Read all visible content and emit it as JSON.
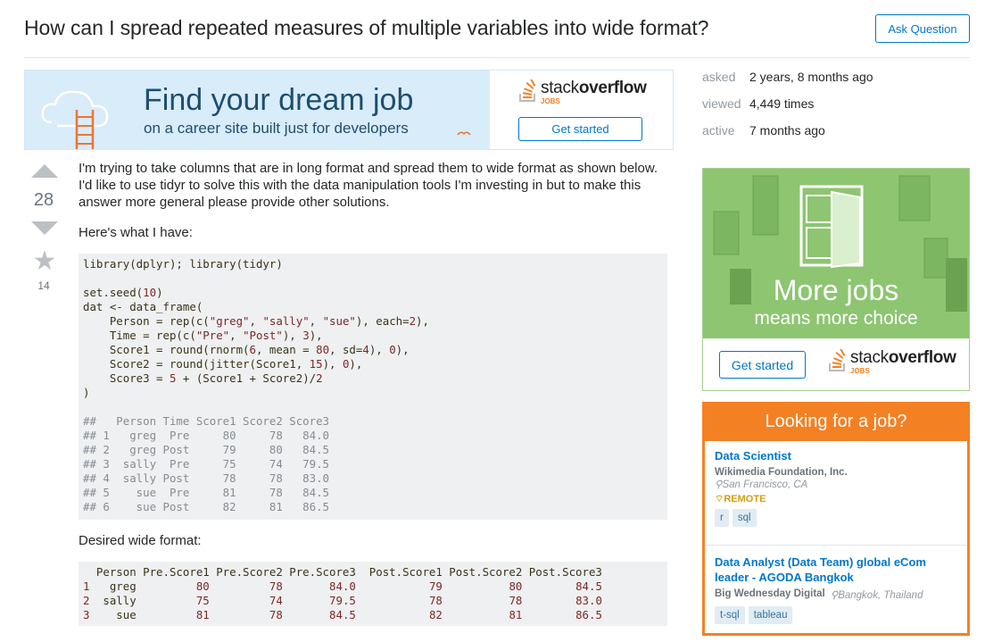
{
  "question": {
    "title": "How can I spread repeated measures of multiple variables into wide format?",
    "ask_button": "Ask Question",
    "votes": "28",
    "favorites": "14",
    "para1": "I'm trying to take columns that are in long format and spread them to wide format as shown below. I'd like to use tidyr to solve this with the data manipulation tools I'm investing in but to make this answer more general please provide other solutions.",
    "para2": "Here's what I have:",
    "para3": "Desired wide format:"
  },
  "banner_ad": {
    "headline": "Find your dream job",
    "subline": "on a career site built just for developers",
    "logo_word_light": "stack",
    "logo_word_bold": "overflow",
    "logo_jobs": "JOBS",
    "button": "Get started"
  },
  "stats": {
    "asked_label": "asked",
    "asked_value": "2 years, 8 months ago",
    "viewed_label": "viewed",
    "viewed_value": "4,449 times",
    "active_label": "active",
    "active_value": "7 months ago"
  },
  "side_ad": {
    "line1": "More jobs",
    "line2": "means more choice",
    "button": "Get started",
    "logo_word_light": "stack",
    "logo_word_bold": "overflow",
    "logo_jobs": "JOBS"
  },
  "jobs": {
    "header": "Looking for a job?",
    "items": [
      {
        "title": "Data Scientist",
        "company": "Wikimedia Foundation, Inc.",
        "location": "San Francisco, CA",
        "remote": "REMOTE",
        "tags": [
          "r",
          "sql"
        ]
      },
      {
        "title": "Data Analyst (Data Team) global eCom leader - AGODA Bangkok",
        "company": "Big Wednesday Digital",
        "location": "Bangkok, Thailand",
        "tags": [
          "t-sql",
          "tableau"
        ]
      }
    ]
  },
  "code1": {
    "lines": [
      "library(dplyr); library(tidyr)",
      "",
      "set.seed(10)",
      "dat <- data_frame(",
      "    Person = rep(c(\"greg\", \"sally\", \"sue\"), each=2),",
      "    Time = rep(c(\"Pre\", \"Post\"), 3),",
      "    Score1 = round(rnorm(6, mean = 80, sd=4), 0),",
      "    Score2 = round(jitter(Score1, 15), 0),",
      "    Score3 = 5 + (Score1 + Score2)/2",
      ")",
      "",
      "##   Person Time Score1 Score2 Score3",
      "## 1   greg  Pre     80     78   84.0",
      "## 2   greg Post     79     80   84.5",
      "## 3  sally  Pre     75     74   79.5",
      "## 4  sally Post     78     78   83.0",
      "## 5    sue  Pre     81     78   84.5",
      "## 6    sue Post     82     81   86.5"
    ]
  },
  "code2": {
    "lines": [
      "  Person Pre.Score1 Pre.Score2 Pre.Score3  Post.Score1 Post.Score2 Post.Score3",
      "1   greg         80         78       84.0           79          80        84.5",
      "2  sally         75         74       79.5           78          78        83.0",
      "3    sue         81         78       84.5           82          81        86.5"
    ]
  }
}
